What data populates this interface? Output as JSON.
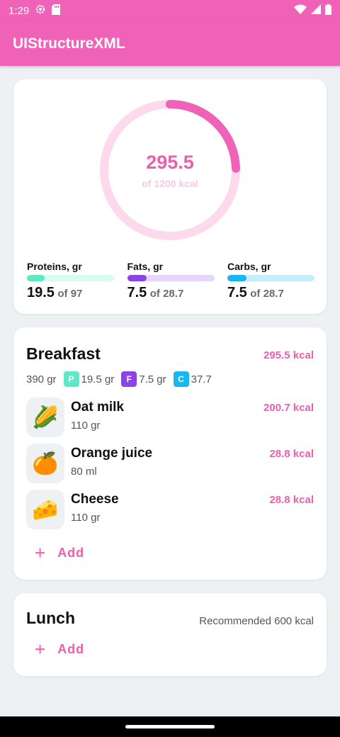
{
  "status": {
    "time": "1:29"
  },
  "app": {
    "title": "UIStructureXML"
  },
  "summary": {
    "value": "295.5",
    "target_text": "of 1200 kcal",
    "progress_fraction": 0.246,
    "colors": {
      "ring_fg": "#f062b8",
      "ring_bg": "#fcd9ec"
    },
    "macros": [
      {
        "label": "Proteins, gr",
        "value": "19.5",
        "of": "of 97",
        "fraction": 0.2,
        "color": "#5ee8c5",
        "track": "#d8fbf2"
      },
      {
        "label": "Fats, gr",
        "value": "7.5",
        "of": "of 28.7",
        "fraction": 0.22,
        "color": "#8a44e8",
        "track": "#e6d6fb"
      },
      {
        "label": "Carbs, gr",
        "value": "7.5",
        "of": "of 28.7",
        "fraction": 0.22,
        "color": "#16b8ef",
        "track": "#c6eefc"
      }
    ]
  },
  "breakfast": {
    "title": "Breakfast",
    "kcal": "295.5 kcal",
    "weight": "390 gr",
    "p_letter": "P",
    "p_value": "19.5 gr",
    "f_letter": "F",
    "f_value": "7.5 gr",
    "c_letter": "C",
    "c_value": "37.7",
    "items": [
      {
        "name": "Oat milk",
        "qty": "110 gr",
        "kcal": "200.7 kcal",
        "icon": "corn-icon",
        "emoji": "🌽"
      },
      {
        "name": "Orange juice",
        "qty": "80 ml",
        "kcal": "28.8 kcal",
        "icon": "orange-icon",
        "emoji": "🍊"
      },
      {
        "name": "Cheese",
        "qty": "110 gr",
        "kcal": "28.8 kcal",
        "icon": "cheese-icon",
        "emoji": "🧀"
      }
    ],
    "add_label": "Add"
  },
  "lunch": {
    "title": "Lunch",
    "recommended": "Recommended 600 kcal",
    "add_label": "Add"
  }
}
